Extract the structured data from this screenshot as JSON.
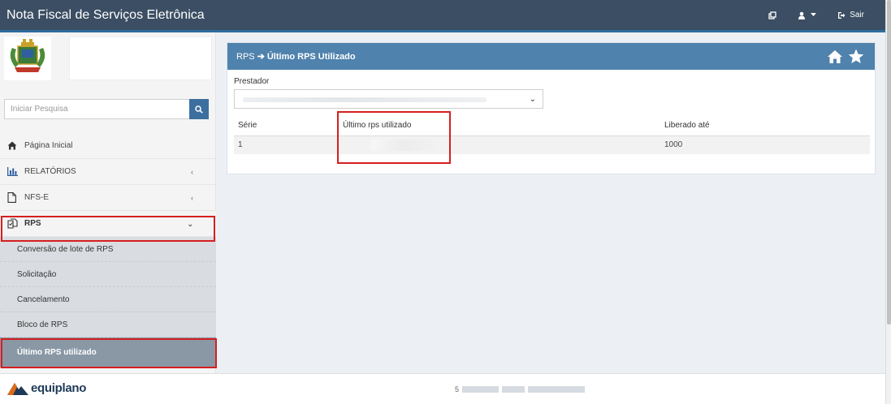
{
  "header": {
    "title": "Nota Fiscal de Serviços Eletrônica",
    "logout_label": "Sair"
  },
  "sidebar": {
    "search_placeholder": "Iniciar Pesquisa",
    "items": [
      {
        "label": "Página Inicial",
        "icon": "home-icon"
      },
      {
        "label": "RELATÓRIOS",
        "icon": "bar-chart-icon"
      },
      {
        "label": "NFS-E",
        "icon": "file-icon"
      },
      {
        "label": "RPS",
        "icon": "copy-docs-icon"
      }
    ],
    "rps_submenu": [
      "Conversão de lote de RPS",
      "Solicitação",
      "Cancelamento",
      "Bloco de RPS",
      "Último RPS utilizado"
    ]
  },
  "panel": {
    "breadcrumb_parent": "RPS",
    "breadcrumb_current": "Último RPS Utilizado",
    "field_label": "Prestador",
    "table": {
      "headers": [
        "Série",
        "Último rps utilizado",
        "Liberado até"
      ],
      "rows": [
        {
          "serie": "1",
          "liberado": "1000"
        }
      ]
    }
  },
  "footer": {
    "brand": "equiplano",
    "info_prefix": "5"
  },
  "colors": {
    "topbar": "#3b4e63",
    "panel_header": "#4f82ad",
    "highlight": "#d61f1f",
    "active_item": "#8a98a6"
  }
}
